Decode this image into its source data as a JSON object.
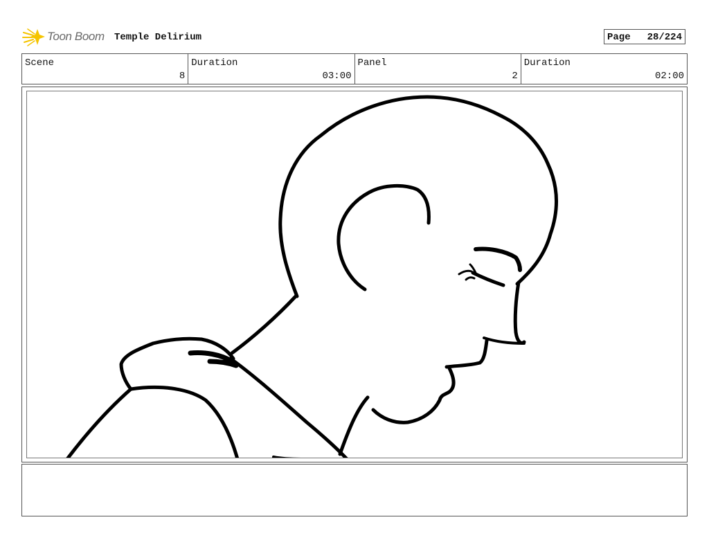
{
  "header": {
    "logo_text": "Toon Boom",
    "project_title": "Temple Delirium",
    "page_label": "Page",
    "page_value": "28/224"
  },
  "info": {
    "scene_label": "Scene",
    "scene_value": "8",
    "scene_duration_label": "Duration",
    "scene_duration_value": "03:00",
    "panel_label": "Panel",
    "panel_value": "2",
    "panel_duration_label": "Duration",
    "panel_duration_value": "02:00"
  },
  "colors": {
    "logo_accent": "#f5c400",
    "logo_text": "#6a6a6a",
    "border": "#555555",
    "ink": "#000000"
  },
  "icons": {
    "logo": "toon-boom-logo-icon"
  }
}
